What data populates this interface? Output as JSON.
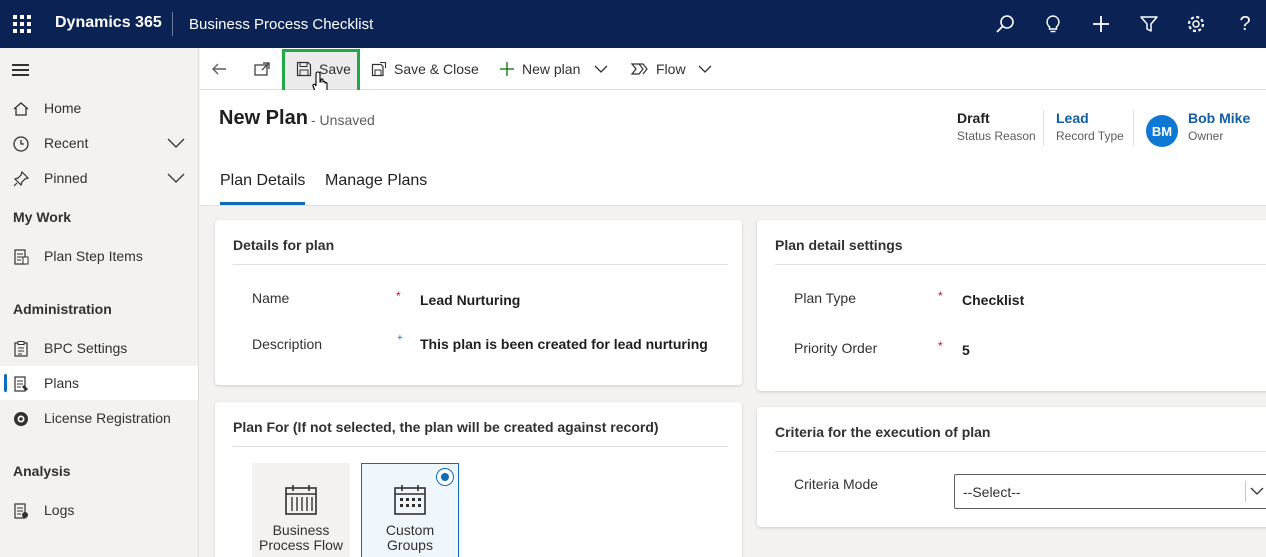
{
  "topbar": {
    "app_name": "Dynamics 365",
    "title": "Business Process Checklist",
    "icons": [
      "search-icon",
      "lightbulb-icon",
      "plus-icon",
      "filter-icon",
      "settings-icon",
      "help-icon"
    ],
    "help_glyph": "?"
  },
  "sidebar": {
    "items": [
      {
        "label": "Home",
        "icon": "home-icon"
      },
      {
        "label": "Recent",
        "icon": "clock-icon"
      },
      {
        "label": "Pinned",
        "icon": "pin-icon"
      }
    ],
    "sections": {
      "my_work": "My Work",
      "administration": "Administration",
      "analysis": "Analysis"
    },
    "my_work_items": [
      {
        "label": "Plan Step Items",
        "icon": "document-icon"
      }
    ],
    "admin_items": [
      {
        "label": "BPC Settings",
        "icon": "clipboard-icon"
      },
      {
        "label": "Plans",
        "icon": "plans-icon",
        "active": true
      },
      {
        "label": "License Registration",
        "icon": "license-icon"
      }
    ],
    "analysis_items": [
      {
        "label": "Logs",
        "icon": "logs-icon"
      }
    ]
  },
  "commandbar": {
    "save": "Save",
    "save_close": "Save & Close",
    "new_plan": "New plan",
    "flow": "Flow"
  },
  "header": {
    "title": "New Plan",
    "subtitle": "- Unsaved",
    "status_value": "Draft",
    "status_label": "Status Reason",
    "record_type_value": "Lead",
    "record_type_label": "Record Type",
    "owner_initials": "BM",
    "owner_value": "Bob Mike",
    "owner_label": "Owner"
  },
  "tabs": [
    "Plan Details",
    "Manage Plans"
  ],
  "details": {
    "title": "Details for plan",
    "name_label": "Name",
    "name_value": "Lead Nurturing",
    "description_label": "Description",
    "description_value": "This plan is been created for lead nurturing",
    "required_mark": "*",
    "recommended_mark": "+"
  },
  "settings": {
    "title": "Plan detail settings",
    "plan_type_label": "Plan Type",
    "plan_type_value": "Checklist",
    "priority_label": "Priority Order",
    "priority_value": "5"
  },
  "plan_for": {
    "title": "Plan For (If not selected, the plan will be created against record)",
    "tiles": [
      {
        "line1": "Business",
        "line2": "Process Flow",
        "selected": false
      },
      {
        "line1": "Custom",
        "line2": "Groups",
        "selected": true
      }
    ]
  },
  "criteria": {
    "title": "Criteria for the execution of plan",
    "mode_label": "Criteria Mode",
    "mode_value": "--Select--"
  },
  "colors": {
    "topbar": "#0b2255",
    "accent": "#0f6cbd",
    "save_highlight": "#22a845"
  }
}
